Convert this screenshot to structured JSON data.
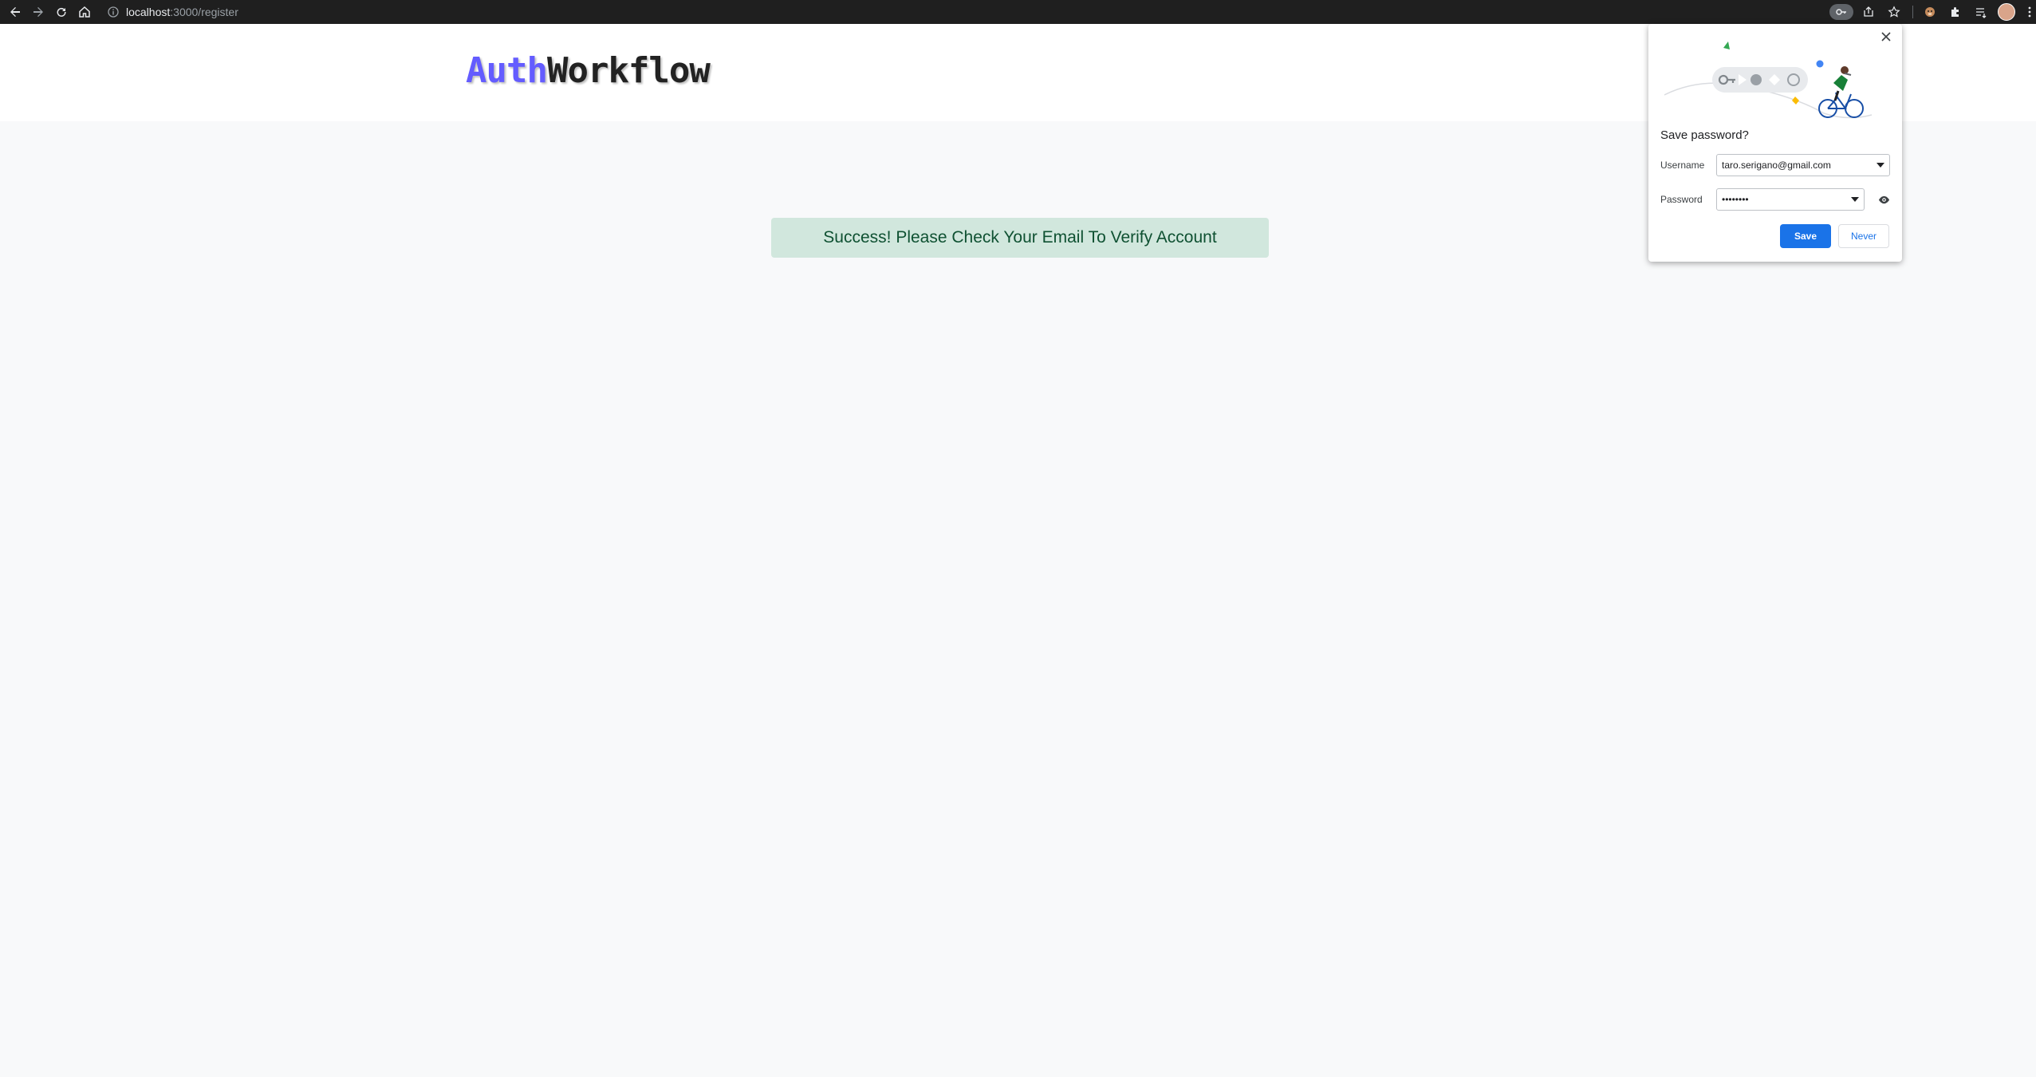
{
  "browser": {
    "url_host": "localhost",
    "url_path": ":3000/register"
  },
  "header": {
    "logo_part1": "Auth",
    "logo_part2": "Workflow"
  },
  "alert": {
    "message": "Success! Please Check Your Email To Verify Account"
  },
  "save_password_popup": {
    "title": "Save password?",
    "username_label": "Username",
    "username_value": "taro.serigano@gmail.com",
    "password_label": "Password",
    "password_value": "••••••••",
    "save_label": "Save",
    "never_label": "Never"
  },
  "colors": {
    "brand_primary": "#645cff",
    "alert_bg": "#d1e7dd",
    "alert_text": "#0f5132",
    "save_button": "#1a73e8"
  }
}
